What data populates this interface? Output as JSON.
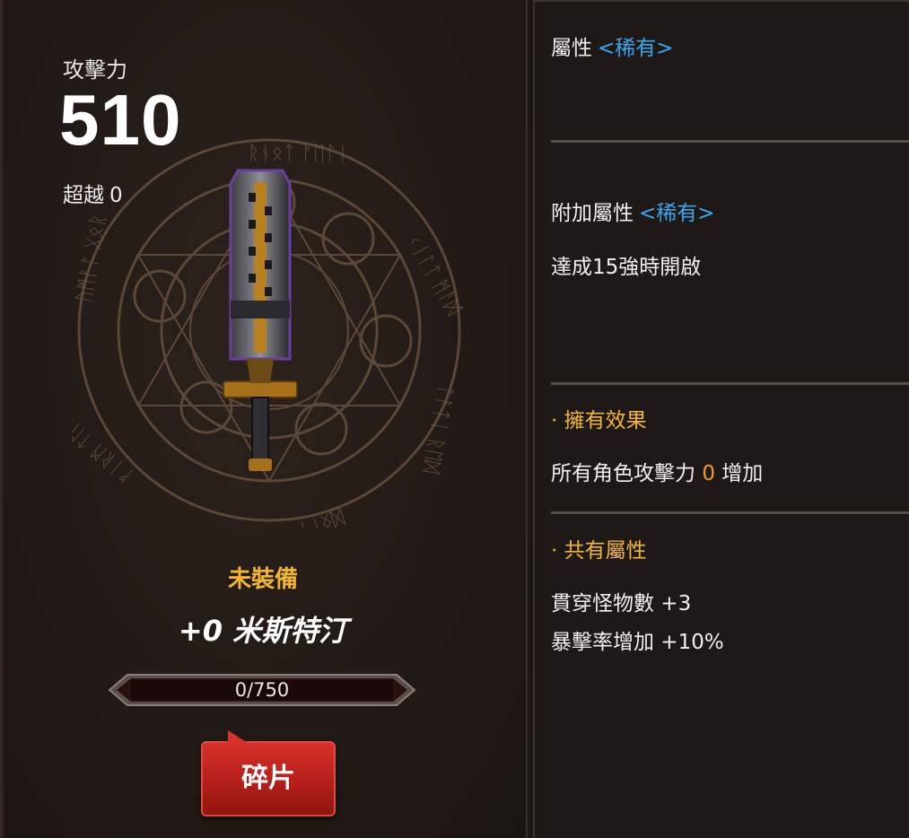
{
  "attack": {
    "label": "攻擊力",
    "value": "510"
  },
  "transcend": {
    "label": "超越",
    "value": "0"
  },
  "item": {
    "status": "未裝備",
    "name": "+0 米斯特汀"
  },
  "shards": {
    "progress_text": "0/750",
    "progress_fraction": 0
  },
  "button": {
    "shard_label": "碎片"
  },
  "details": {
    "attribute_label": "屬性",
    "attribute_rarity": "<稀有>",
    "extra_attribute_label": "附加屬性",
    "extra_attribute_rarity": "<稀有>",
    "extra_attribute_note": "達成15強時開啟",
    "owned_effect_title": "· 擁有效果",
    "owned_effect_prefix": "所有角色攻擊力",
    "owned_effect_value": "0",
    "owned_effect_suffix": "增加",
    "shared_attribute_title": "· 共有屬性",
    "shared_attributes": [
      "貫穿怪物數 +3",
      "暴擊率增加 +10%"
    ]
  },
  "colors": {
    "rarity_blue": "#3aa6f0",
    "gold": "#f2b632",
    "button_red": "#c2241e"
  },
  "icons": [
    "magic-circle-icon",
    "sword-icon"
  ]
}
